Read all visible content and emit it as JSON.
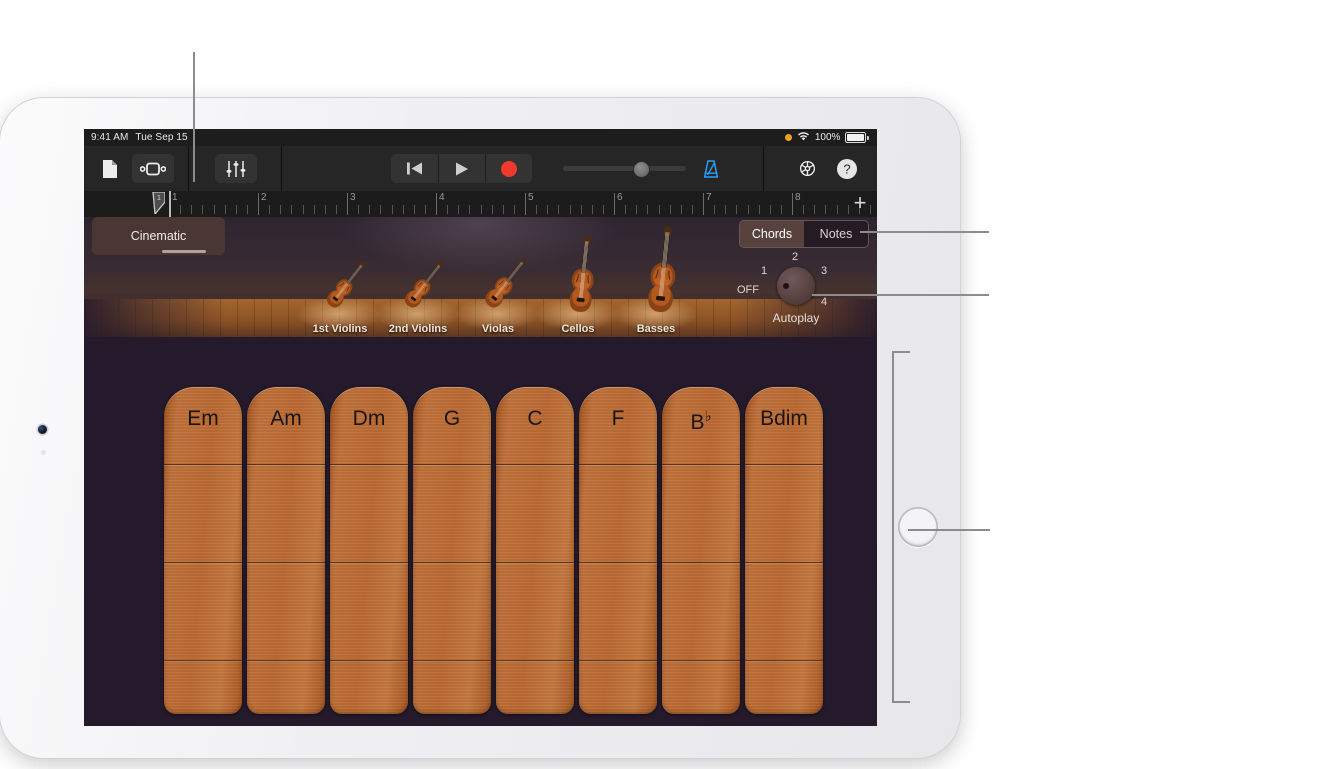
{
  "device": {
    "name": "iPad",
    "orientation": "landscape"
  },
  "statusbar": {
    "time": "9:41 AM",
    "date": "Tue Sep 15",
    "recording_indicator": "orange-dot",
    "wifi": "wifi-icon",
    "battery_percent": "100%"
  },
  "toolbar": {
    "browser_label": "browser-icon",
    "tracks_label": "tracks-view-icon",
    "mixer_label": "mixer-icon",
    "rewind_label": "rewind-icon",
    "play_label": "play-icon",
    "record_label": "record-icon",
    "metronome_label": "metronome-icon",
    "settings_label": "gear-icon",
    "help_label": "?",
    "volume_value": 58
  },
  "ruler": {
    "bars": [
      "1",
      "2",
      "3",
      "4",
      "5",
      "6",
      "7",
      "8"
    ],
    "playhead_bar": "1",
    "add_label": "+"
  },
  "instrument": {
    "preset_name": "Cinematic",
    "mode_tabs": [
      {
        "label": "Chords",
        "selected": true
      },
      {
        "label": "Notes",
        "selected": false
      }
    ],
    "autoplay": {
      "title": "Autoplay",
      "off_label": "OFF",
      "positions": [
        "1",
        "2",
        "3",
        "4"
      ],
      "selected": "OFF"
    },
    "stage_sections": [
      {
        "label": "1st Violins"
      },
      {
        "label": "2nd Violins"
      },
      {
        "label": "Violas"
      },
      {
        "label": "Cellos"
      },
      {
        "label": "Basses"
      }
    ],
    "chord_strips": [
      {
        "root": "Em",
        "flat": ""
      },
      {
        "root": "Am",
        "flat": ""
      },
      {
        "root": "Dm",
        "flat": ""
      },
      {
        "root": "G",
        "flat": ""
      },
      {
        "root": "C",
        "flat": ""
      },
      {
        "root": "F",
        "flat": ""
      },
      {
        "root": "B",
        "flat": "♭"
      },
      {
        "root": "Bdim",
        "flat": ""
      }
    ]
  },
  "colors": {
    "app_background": "#191919",
    "surface_background": "#241a2b",
    "strip_wood": "#bb6a33",
    "preset_pill": "#4a3733",
    "accent_blue": "#2a9df4",
    "record_red": "#f03a2e"
  }
}
